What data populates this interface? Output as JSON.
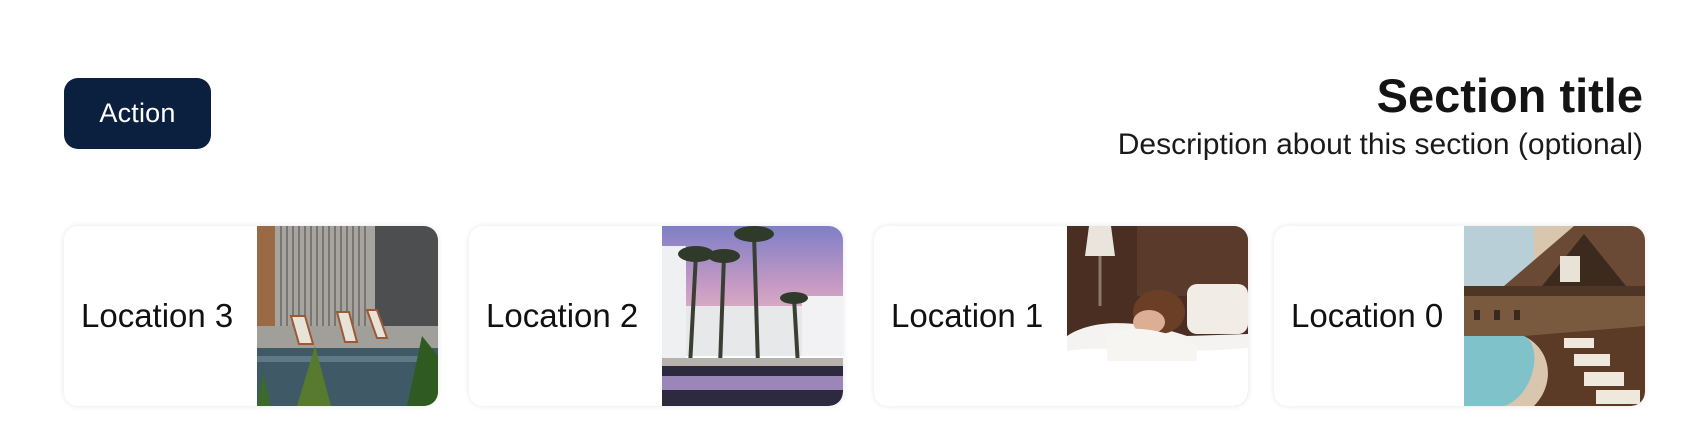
{
  "header": {
    "action_label": "Action",
    "title": "Section title",
    "description": "Description about this section (optional)"
  },
  "cards": [
    {
      "label": "Location 3",
      "image": "pool-with-deck-chairs-photo"
    },
    {
      "label": "Location 2",
      "image": "palm-trees-pool-sunset-photo"
    },
    {
      "label": "Location 1",
      "image": "person-sleeping-in-bed-photo"
    },
    {
      "label": "Location 0",
      "image": "resort-lodge-pool-photo"
    }
  ],
  "colors": {
    "action_bg": "#0b1f3f",
    "action_text": "#ffffff",
    "text": "#111111"
  }
}
